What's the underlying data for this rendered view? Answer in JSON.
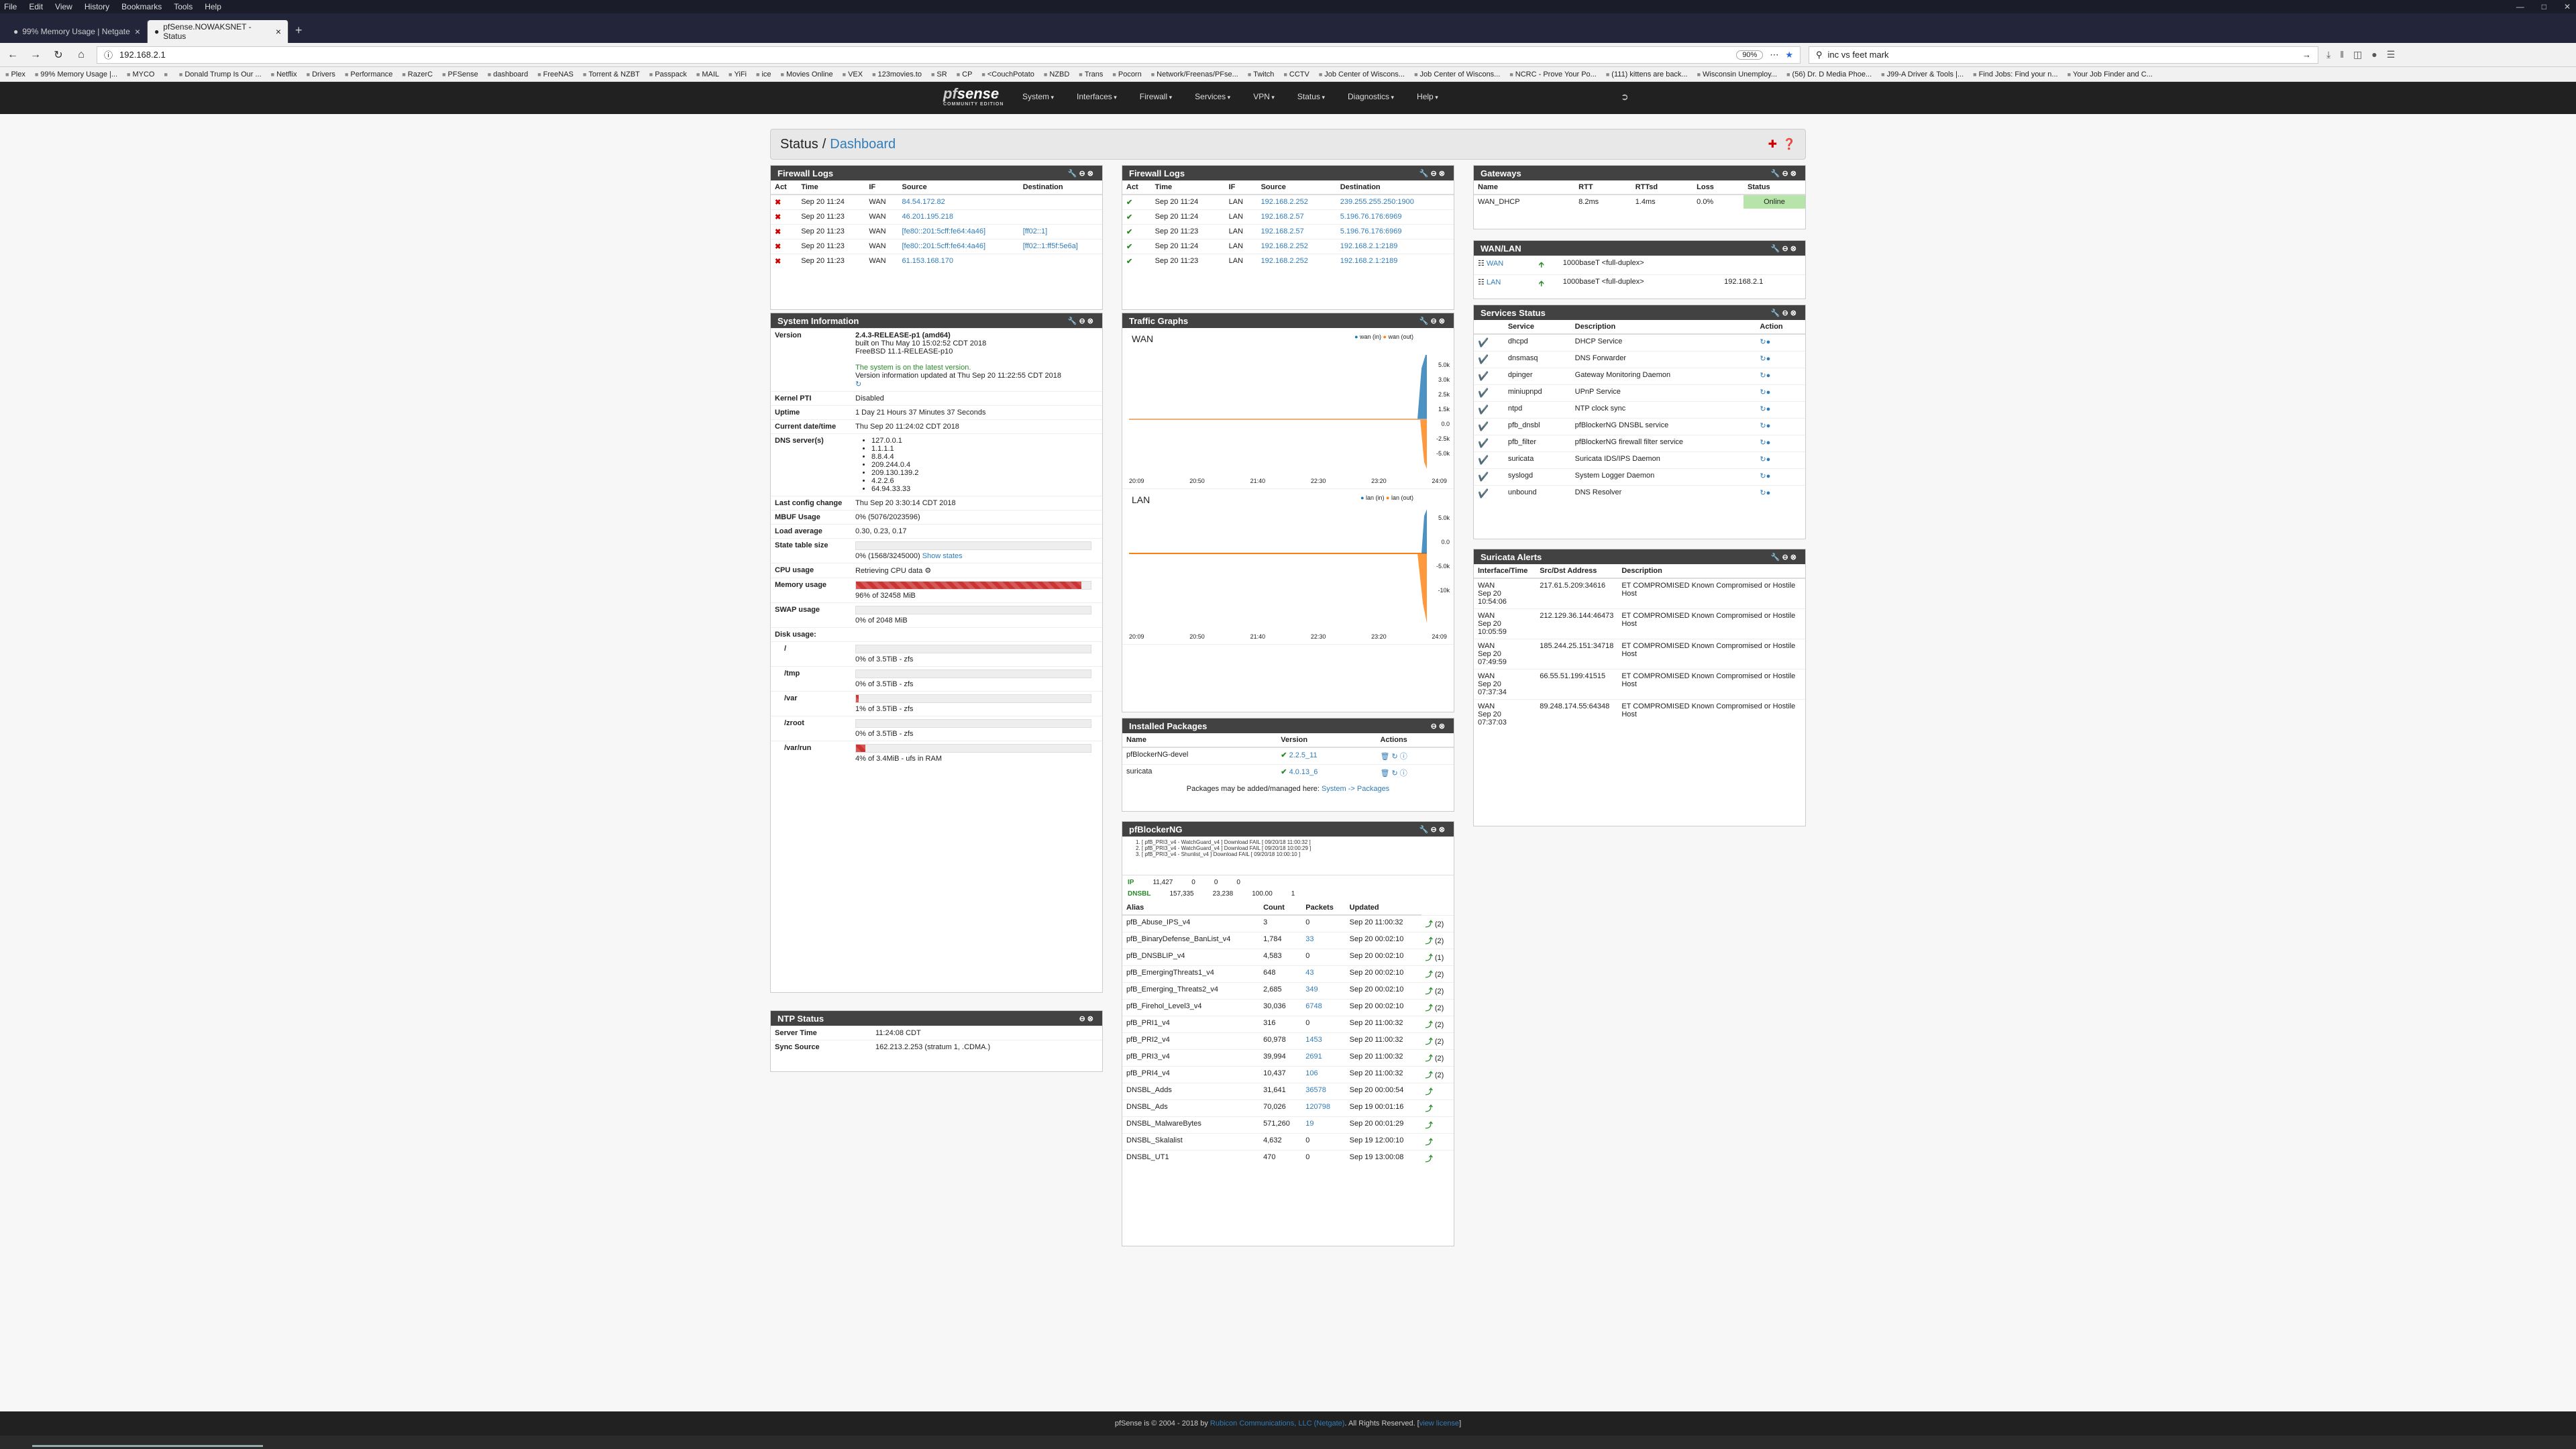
{
  "browser": {
    "menu": [
      "File",
      "Edit",
      "View",
      "History",
      "Bookmarks",
      "Tools",
      "Help"
    ],
    "tabs": [
      {
        "title": "99% Memory Usage | Netgate"
      },
      {
        "title": "pfSense.NOWAKSNET - Status"
      }
    ],
    "url": "192.168.2.1",
    "zoom": "90%",
    "search": "inc vs feet mark",
    "bookmarks": [
      "Plex",
      "99% Memory Usage |...",
      "MYCO",
      "",
      "Donald Trump Is Our ...",
      "Netflix",
      "Drivers",
      "Performance",
      "RazerC",
      "PFSense",
      "dashboard",
      "FreeNAS",
      "Torrent & NZBT",
      "Passpack",
      "MAIL",
      "YiFi",
      "ice",
      "Movies Online",
      "VEX",
      "123movies.to",
      "SR",
      "CP",
      "<CouchPotato",
      "NZBD",
      "Trans",
      "Pocorn",
      "Network/Freenas/PFse...",
      "Twitch",
      "CCTV",
      "Job Center of Wiscons...",
      "Job Center of Wiscons...",
      "NCRC - Prove Your Po...",
      "(111) kittens are back...",
      "Wisconsin Unemploy...",
      "(56) Dr. D Media Phoe...",
      "J99-A Driver & Tools |...",
      "Find Jobs: Find your n...",
      "Your Job Finder and C..."
    ]
  },
  "nav": {
    "logo": "sense",
    "logo_sub": "COMMUNITY EDITION",
    "menus": [
      "System",
      "Interfaces",
      "Firewall",
      "Services",
      "VPN",
      "Status",
      "Diagnostics",
      "Help"
    ]
  },
  "breadcrumb": {
    "parent": "Status",
    "sep": "/",
    "current": "Dashboard"
  },
  "fw1": {
    "title": "Firewall Logs",
    "headers": [
      "Act",
      "Time",
      "IF",
      "Source",
      "Destination"
    ],
    "rows": [
      [
        "✖",
        "Sep 20 11:24",
        "WAN",
        "84.54.172.82",
        ""
      ],
      [
        "✖",
        "Sep 20 11:23",
        "WAN",
        "46.201.195.218",
        ""
      ],
      [
        "✖",
        "Sep 20 11:23",
        "WAN",
        "[fe80::201:5cff:fe64:4a46]",
        "[ff02::1]"
      ],
      [
        "✖",
        "Sep 20 11:23",
        "WAN",
        "[fe80::201:5cff:fe64:4a46]",
        "[ff02::1:ff5f:5e6a]"
      ],
      [
        "✖",
        "Sep 20 11:23",
        "WAN",
        "61.153.168.170",
        ""
      ]
    ]
  },
  "fw2": {
    "title": "Firewall Logs",
    "headers": [
      "Act",
      "Time",
      "IF",
      "Source",
      "Destination"
    ],
    "rows": [
      [
        "✔",
        "Sep 20 11:24",
        "LAN",
        "192.168.2.252",
        "239.255.255.250:1900"
      ],
      [
        "✔",
        "Sep 20 11:24",
        "LAN",
        "192.168.2.57",
        "5.196.76.176:6969"
      ],
      [
        "✔",
        "Sep 20 11:23",
        "LAN",
        "192.168.2.57",
        "5.196.76.176:6969"
      ],
      [
        "✔",
        "Sep 20 11:24",
        "LAN",
        "192.168.2.252",
        "192.168.2.1:2189"
      ],
      [
        "✔",
        "Sep 20 11:23",
        "LAN",
        "192.168.2.252",
        "192.168.2.1:2189"
      ]
    ]
  },
  "sysinfo": {
    "title": "System Information",
    "version": [
      "2.4.3-RELEASE-p1 (amd64)",
      "built on Thu May 10 15:02:52 CDT 2018",
      "FreeBSD 11.1-RELEASE-p10"
    ],
    "latest": "The system is on the latest version.",
    "updated": "Version information updated at Thu Sep 20 11:22:55 CDT 2018",
    "rows": [
      [
        "Kernel PTI",
        "Disabled"
      ],
      [
        "Uptime",
        "1 Day 21 Hours 37 Minutes 37 Seconds"
      ],
      [
        "Current date/time",
        "Thu Sep 20 11:24:02 CDT 2018"
      ]
    ],
    "dns_label": "DNS server(s)",
    "dns": [
      "127.0.0.1",
      "1.1.1.1",
      "8.8.4.4",
      "209.244.0.4",
      "209.130.139.2",
      "4.2.2.6",
      "64.94.33.33"
    ],
    "lastconfig": [
      "Last config change",
      "Thu Sep 20 3:30:14 CDT 2018"
    ],
    "state": [
      "State table size",
      "0% (1568/3245000)",
      "Show states"
    ],
    "mbuf": [
      "MBUF Usage",
      "0% (5076/2023596)"
    ],
    "load": [
      "Load average",
      "0.30, 0.23, 0.17"
    ],
    "cpu": [
      "CPU usage",
      "Retrieving CPU data"
    ],
    "mem": [
      "Memory usage",
      "96% of 32458 MiB"
    ],
    "mem_pct": 96,
    "swap": [
      "SWAP usage",
      "0% of 2048 MiB"
    ],
    "disk_label": "Disk usage:",
    "disks": [
      {
        "m": "/",
        "t": "0% of 3.5TiB - zfs",
        "p": 0
      },
      {
        "m": "/tmp",
        "t": "0% of 3.5TiB - zfs",
        "p": 0
      },
      {
        "m": "/var",
        "t": "1% of 3.5TiB - zfs",
        "p": 1
      },
      {
        "m": "/zroot",
        "t": "0% of 3.5TiB - zfs",
        "p": 0
      },
      {
        "m": "/var/run",
        "t": "4% of 3.4MiB - ufs in RAM",
        "p": 4
      }
    ]
  },
  "ntp": {
    "title": "NTP Status",
    "rows": [
      [
        "Server Time",
        "11:24:08 CDT"
      ],
      [
        "Sync Source",
        "162.213.2.253 (stratum 1, .CDMA.)"
      ]
    ]
  },
  "traffic": {
    "title": "Traffic Graphs",
    "wan": {
      "name": "WAN",
      "in": "wan (in)",
      "out": "wan (out)",
      "y": [
        "5.0k",
        "3.0k",
        "2.5k",
        "1.5k",
        "0.0",
        "-2.5k",
        "-5.0k"
      ]
    },
    "lan": {
      "name": "LAN",
      "in": "lan (in)",
      "out": "lan (out)",
      "y": [
        "5.0k",
        "0.0",
        "-5.0k",
        "-10k"
      ]
    },
    "x": [
      "20:09",
      "20:50",
      "21:40",
      "22:30",
      "23:20",
      "24:09"
    ]
  },
  "pkgs": {
    "title": "Installed Packages",
    "headers": [
      "Name",
      "Version",
      "Actions"
    ],
    "rows": [
      [
        "pfBlockerNG-devel",
        "2.2.5_11"
      ],
      [
        "suricata",
        "4.0.13_6"
      ]
    ],
    "note": "Packages may be added/managed here:",
    "link": "System -> Packages"
  },
  "pfb": {
    "title": "pfBlockerNG",
    "log": [
      "1. [ pfB_PRI3_v4 - WatchGuard_v4 ] Download FAIL [ 09/20/18 11:00:32 ]",
      "2. [ pfB_PRI3_v4 - WatchGuard_v4 ] Download FAIL [ 09/20/18 10:00:29 ]",
      "3. [ pfB_PRI3_v4 - Shunlist_v4 ] Download FAIL [ 09/20/18 10:00:10 ]"
    ],
    "ip": [
      "IP",
      "11,427",
      "0",
      "0",
      "0"
    ],
    "dnsbl": [
      "DNSBL",
      "157,335",
      "23,238",
      "100.00",
      "1"
    ],
    "headers": [
      "Alias",
      "Count",
      "Packets",
      "Updated"
    ],
    "rows": [
      [
        "pfB_Abuse_IPS_v4",
        "3",
        "0",
        "Sep 20 11:00:32",
        "(2)"
      ],
      [
        "pfB_BinaryDefense_BanList_v4",
        "1,784",
        "33",
        "Sep 20 00:02:10",
        "(2)"
      ],
      [
        "pfB_DNSBLIP_v4",
        "4,583",
        "0",
        "Sep 20 00:02:10",
        "(1)"
      ],
      [
        "pfB_EmergingThreats1_v4",
        "648",
        "43",
        "Sep 20 00:02:10",
        "(2)"
      ],
      [
        "pfB_Emerging_Threats2_v4",
        "2,685",
        "349",
        "Sep 20 00:02:10",
        "(2)"
      ],
      [
        "pfB_Firehol_Level3_v4",
        "30,036",
        "6748",
        "Sep 20 00:02:10",
        "(2)"
      ],
      [
        "pfB_PRI1_v4",
        "316",
        "0",
        "Sep 20 11:00:32",
        "(2)"
      ],
      [
        "pfB_PRI2_v4",
        "60,978",
        "1453",
        "Sep 20 11:00:32",
        "(2)"
      ],
      [
        "pfB_PRI3_v4",
        "39,994",
        "2691",
        "Sep 20 11:00:32",
        "(2)"
      ],
      [
        "pfB_PRI4_v4",
        "10,437",
        "106",
        "Sep 20 11:00:32",
        "(2)"
      ],
      [
        "DNSBL_Adds",
        "31,641",
        "36578",
        "Sep 20 00:00:54",
        ""
      ],
      [
        "DNSBL_Ads",
        "70,026",
        "120798",
        "Sep 19 00:01:16",
        ""
      ],
      [
        "DNSBL_MalwareBytes",
        "571,260",
        "19",
        "Sep 20 00:01:29",
        ""
      ],
      [
        "DNSBL_Skalalist",
        "4,632",
        "0",
        "Sep 19 12:00:10",
        ""
      ],
      [
        "DNSBL_UT1",
        "470",
        "0",
        "Sep 19 13:00:08",
        ""
      ]
    ]
  },
  "gw": {
    "title": "Gateways",
    "headers": [
      "Name",
      "RTT",
      "RTTsd",
      "Loss",
      "Status"
    ],
    "rows": [
      [
        "WAN_DHCP",
        "8.2ms",
        "1.4ms",
        "0.0%",
        "Online"
      ]
    ]
  },
  "wanlan": {
    "title": "WAN/LAN",
    "rows": [
      [
        "WAN",
        "1000baseT <full-duplex>",
        ""
      ],
      [
        "LAN",
        "1000baseT <full-duplex>",
        "192.168.2.1"
      ]
    ]
  },
  "svc": {
    "title": "Services Status",
    "headers": [
      "Service",
      "Description",
      "Action"
    ],
    "rows": [
      [
        "dhcpd",
        "DHCP Service"
      ],
      [
        "dnsmasq",
        "DNS Forwarder"
      ],
      [
        "dpinger",
        "Gateway Monitoring Daemon"
      ],
      [
        "miniupnpd",
        "UPnP Service"
      ],
      [
        "ntpd",
        "NTP clock sync"
      ],
      [
        "pfb_dnsbl",
        "pfBlockerNG DNSBL service"
      ],
      [
        "pfb_filter",
        "pfBlockerNG firewall filter service"
      ],
      [
        "suricata",
        "Suricata IDS/IPS Daemon"
      ],
      [
        "syslogd",
        "System Logger Daemon"
      ],
      [
        "unbound",
        "DNS Resolver"
      ]
    ]
  },
  "sur": {
    "title": "Suricata Alerts",
    "headers": [
      "Interface/Time",
      "Src/Dst Address",
      "Description"
    ],
    "rows": [
      [
        "WAN",
        "Sep 20 10:54:06",
        "217.61.5.209:34616",
        "ET COMPROMISED Known Compromised or Hostile Host"
      ],
      [
        "WAN",
        "Sep 20 10:05:59",
        "212.129.36.144:46473",
        "ET COMPROMISED Known Compromised or Hostile Host"
      ],
      [
        "WAN",
        "Sep 20 07:49:59",
        "185.244.25.151:34718",
        "ET COMPROMISED Known Compromised or Hostile Host"
      ],
      [
        "WAN",
        "Sep 20 07:37:34",
        "66.55.51.199:41515",
        "ET COMPROMISED Known Compromised or Hostile Host"
      ],
      [
        "WAN",
        "Sep 20 07:37:03",
        "89.248.174.55:64348",
        "ET COMPROMISED Known Compromised or Hostile Host"
      ]
    ]
  },
  "footer": {
    "a": "pfSense is © 2004 - 2018 by",
    "b": "Rubicon Communications, LLC (Netgate)",
    "c": ". All Rights Reserved. [",
    "d": "view license",
    "e": "]"
  }
}
